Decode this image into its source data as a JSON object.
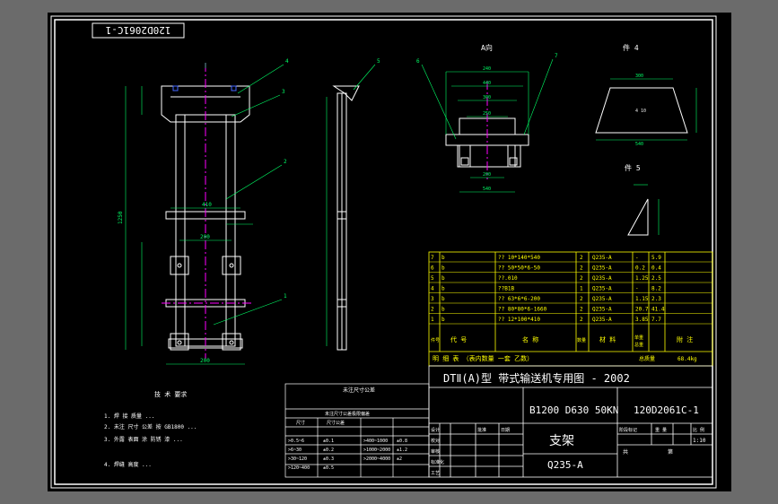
{
  "drawing": {
    "stamp": "120D2061C-1",
    "section_label": "A向",
    "part4_label": "件 4",
    "part5_label": "件 5",
    "tech_title": "技 术 要求",
    "notes": [
      "1. 焊 接 质量 ...",
      "2. 未注 尺寸 公差 按 GB1800 ...",
      "3. 外露 表面 涂 防锈 漆 ...",
      "4. 焊缝 高度 ..."
    ]
  },
  "dims": {
    "front_width": "410",
    "front_w2": "200",
    "front_w3": "200",
    "front_height": "1250",
    "sec_240": "240",
    "sec_440": "440",
    "sec_300": "300",
    "sec_250": "250",
    "sec_200": "200",
    "sec_w": "540",
    "p4_top": "300",
    "p4_bot": "540",
    "p4_mid": "4 10"
  },
  "callouts": [
    "1",
    "2",
    "3",
    "4",
    "5",
    "6",
    "7"
  ],
  "bom": {
    "rows": [
      {
        "no": "7",
        "code": "b",
        "name": "?? 10*140*540",
        "qty": "2",
        "mat": "Q235-A",
        "w1": "-",
        "w2": "5.9"
      },
      {
        "no": "6",
        "code": "b",
        "name": "?? 50*50*6-50",
        "qty": "2",
        "mat": "Q235-A",
        "w1": "0.2",
        "w2": "0.4"
      },
      {
        "no": "5",
        "code": "b",
        "name": "??.010",
        "qty": "2",
        "mat": "Q235-A",
        "w1": "1.25",
        "w2": "2.5"
      },
      {
        "no": "4",
        "code": "b",
        "name": "??B1B",
        "qty": "1",
        "mat": "Q235-A",
        "w1": "-",
        "w2": "8.2"
      },
      {
        "no": "3",
        "code": "b",
        "name": "?? 63*6*6-200",
        "qty": "2",
        "mat": "Q235-A",
        "w1": "1.15",
        "w2": "2.3"
      },
      {
        "no": "2",
        "code": "b",
        "name": "?? 80*80*6-1660",
        "qty": "2",
        "mat": "Q235-A",
        "w1": "20.7",
        "w2": "41.4"
      },
      {
        "no": "1",
        "code": "b",
        "name": "?? 12*100*410",
        "qty": "2",
        "mat": "Q235-A",
        "w1": "3.85",
        "w2": "7.7"
      }
    ],
    "header": {
      "no": "件号",
      "code": "代 号",
      "name": "名 称",
      "qty": "数量",
      "mat": "材 料",
      "unit_w": "单重",
      "total_w": "总重",
      "remark": "附 注"
    },
    "footer_left": "明 细 表 （表内数量 一套 乙数）",
    "footer_total_label": "总质量",
    "footer_total": "68.4kg"
  },
  "title_block": {
    "series_title": "DTⅡ(A)型  带式输送机专用图 - 2002",
    "spec": "B1200 D630 50KN",
    "drawing_no": "120D2061C-1",
    "part_name": "支架",
    "material": "Q235-A",
    "scale": "1:10",
    "scale_label": "比 例",
    "stage_label": "阶段标记",
    "weight_label": "重 量",
    "total_sheets": "共",
    "sheet": "第",
    "approve": "审核",
    "design": "设计",
    "check": "校对",
    "std": "标准化",
    "process": "工艺",
    "approve2": "批准",
    "date": "日期"
  },
  "tol_table": {
    "title": "未注尺寸公差",
    "header": "未注尺寸公差极限偏差",
    "col1": "尺寸",
    "col2": "尺寸公差",
    "rows": [
      {
        "a": ">0.5~6",
        "b": "±0.1",
        "c": ">400~1000",
        "d": "±0.8"
      },
      {
        "a": ">6~30",
        "b": "±0.2",
        "c": ">1000~2000",
        "d": "±1.2"
      },
      {
        "a": ">30~120",
        "b": "±0.3",
        "c": ">2000~4000",
        "d": "±2"
      },
      {
        "a": ">120~400",
        "b": "±0.5",
        "c": "",
        "d": ""
      }
    ]
  },
  "colors": {
    "bg": "#000000",
    "frame": "#ffffff",
    "bom": "#ffff00",
    "part": "#e8e8e8",
    "center": "#ff00ff",
    "dim": "#00ff66",
    "callout": "#00ff66",
    "bolt": "#0000ff"
  }
}
